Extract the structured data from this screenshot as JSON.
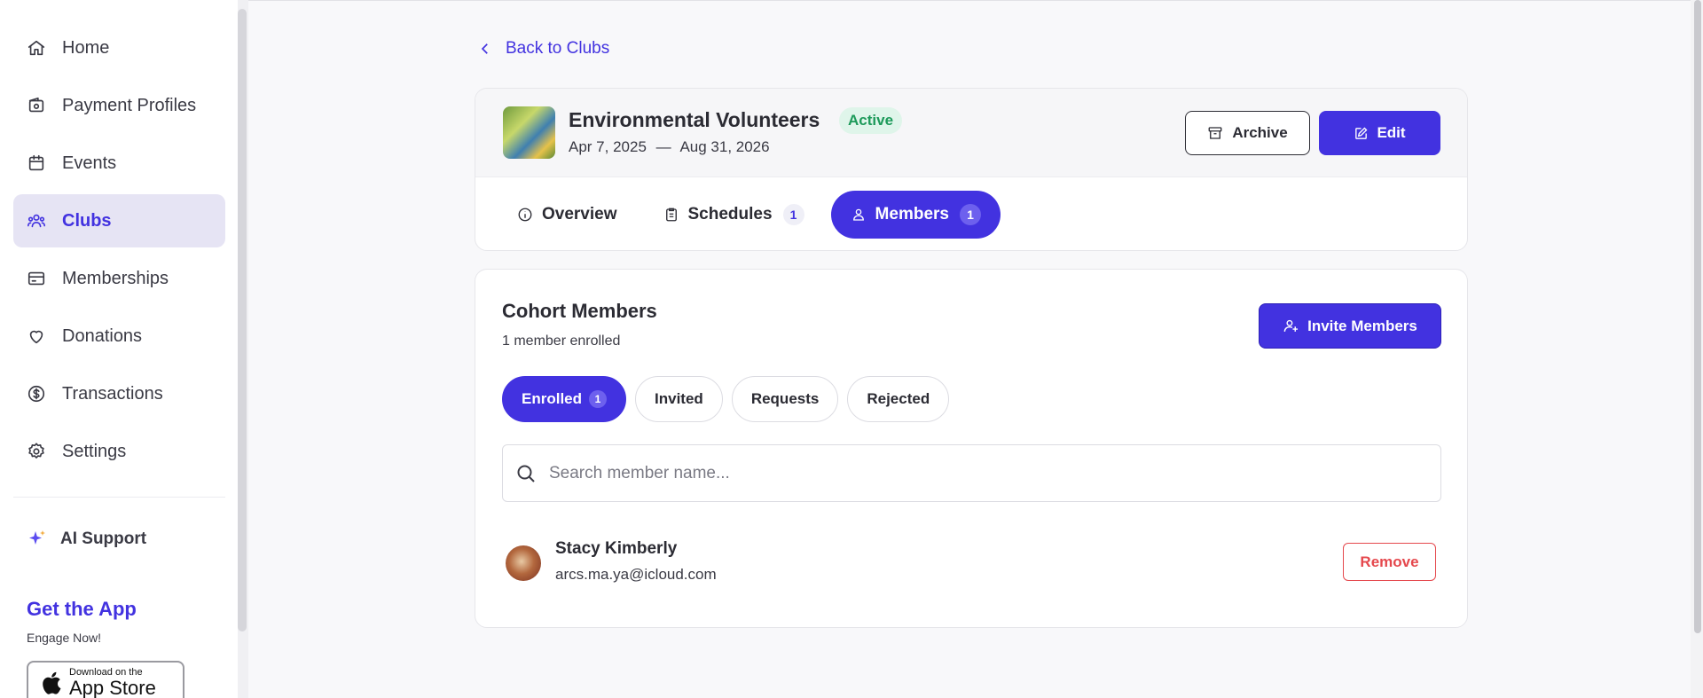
{
  "sidebar": {
    "items": [
      {
        "label": "Home",
        "icon": "home-icon"
      },
      {
        "label": "Payment Profiles",
        "icon": "wallet-icon"
      },
      {
        "label": "Events",
        "icon": "calendar-icon"
      },
      {
        "label": "Clubs",
        "icon": "users-icon",
        "active": true
      },
      {
        "label": "Memberships",
        "icon": "card-icon"
      },
      {
        "label": "Donations",
        "icon": "heart-icon"
      },
      {
        "label": "Transactions",
        "icon": "dollar-icon"
      },
      {
        "label": "Settings",
        "icon": "gear-icon"
      }
    ],
    "ai_support": "AI Support",
    "get_app": "Get the App",
    "engage": "Engage Now!",
    "appstore_small": "Download on the",
    "appstore_big": "App Store"
  },
  "back_link": "Back to Clubs",
  "club": {
    "name": "Environmental Volunteers",
    "status": "Active",
    "start_date": "Apr 7, 2025",
    "date_separator": "—",
    "end_date": "Aug 31, 2026",
    "archive_label": "Archive",
    "edit_label": "Edit"
  },
  "tabs": [
    {
      "label": "Overview",
      "count": null
    },
    {
      "label": "Schedules",
      "count": "1"
    },
    {
      "label": "Members",
      "count": "1",
      "active": true
    }
  ],
  "members": {
    "title": "Cohort Members",
    "subtitle": "1 member enrolled",
    "invite_label": "Invite Members",
    "filters": [
      {
        "label": "Enrolled",
        "count": "1",
        "active": true
      },
      {
        "label": "Invited"
      },
      {
        "label": "Requests"
      },
      {
        "label": "Rejected"
      }
    ],
    "search_placeholder": "Search member name...",
    "list": [
      {
        "name": "Stacy Kimberly",
        "email": "arcs.ma.ya@icloud.com",
        "action": "Remove"
      }
    ]
  },
  "colors": {
    "accent": "#4232e0",
    "active_badge_bg": "#dff5ea",
    "active_badge_text": "#1d9a5a",
    "danger": "#e5484d"
  }
}
